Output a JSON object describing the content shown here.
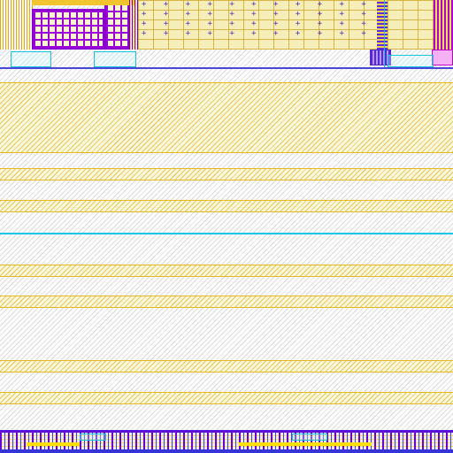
{
  "layout_view": {
    "cells": [
      {
        "name": "cell-block-left"
      },
      {
        "name": "cell-block-plus-array"
      },
      {
        "name": "cell-block-right"
      }
    ],
    "colors": {
      "hatch_yellow": "#e0be28",
      "metal_purple": "#9b00d6",
      "metal_blue": "#4a46d8",
      "via_cyan": "#16c6e6",
      "background": "#ffffff"
    },
    "plus_array_rows": [
      "+ + + + + + + + + + + + + + + +",
      "+ + + + + + + + + + + + + + + +",
      "+ + + + + + + + + + + + + + + +",
      "+ + + + + + + + + + + + + + + +"
    ]
  }
}
